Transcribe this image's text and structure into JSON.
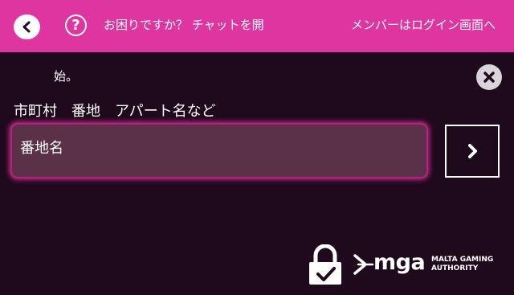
{
  "header": {
    "help_text": "お困りですか？ チャットを開",
    "member_text": "メンバーはログイン画面へ"
  },
  "help_continuation": "始。",
  "address": {
    "label": "市町村　番地　アパート名など",
    "placeholder": "番地名"
  },
  "footer": {
    "mga_brand": "mga",
    "mga_line1": "MALTA GAMING",
    "mga_line2": "AUTHORITY"
  },
  "colors": {
    "header_bg": "#df35a0",
    "page_bg": "#1e0a1c",
    "input_bg": "#5a3148",
    "input_glow": "#e632a0"
  },
  "icons": [
    "back-chevron-icon",
    "help-circle-icon",
    "close-icon",
    "next-chevron-icon",
    "lock-check-icon",
    "mga-logo"
  ]
}
